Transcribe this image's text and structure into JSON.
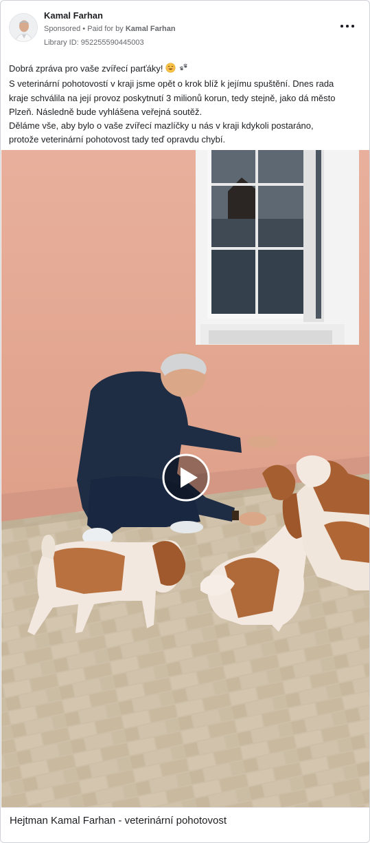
{
  "post": {
    "author_name": "Kamal Farhan",
    "sponsored_label": "Sponsored",
    "separator": "•",
    "paid_for_prefix": "Paid for by",
    "paid_for_name": "Kamal Farhan",
    "library_id": "Library ID: 952255590445003",
    "more_icon": "more-horizontal-icon"
  },
  "text": {
    "line1": "Dobrá zpráva pro vaše zvířecí parťáky!",
    "line1_emojis": [
      "smiling-face-icon",
      "paw-prints-icon"
    ],
    "line2": "S veterinární pohotovostí v kraji jsme opět o krok blíž k jejímu spuštění. Dnes rada",
    "line3": "kraje schválila na její provoz poskytnutí 3 milionů korun, tedy stejně, jako dá město",
    "line4": "Plzeň. Následně bude vyhlášena veřejná soutěž.",
    "line5": "Děláme vše, aby bylo o vaše zvířecí mazlíčky u nás v kraji kdykoli postaráno,",
    "line6": "protože veterinární pohotovost tady teď opravdu chybí."
  },
  "media": {
    "type": "video",
    "play_icon": "play-icon"
  },
  "caption": {
    "title": "Hejtman Kamal Farhan - veterinární pohotovost"
  },
  "colors": {
    "wall": "#e4a994",
    "window_frame": "#f2f2f2",
    "pavement": "#cdbfa8",
    "text_secondary": "#65676b"
  }
}
